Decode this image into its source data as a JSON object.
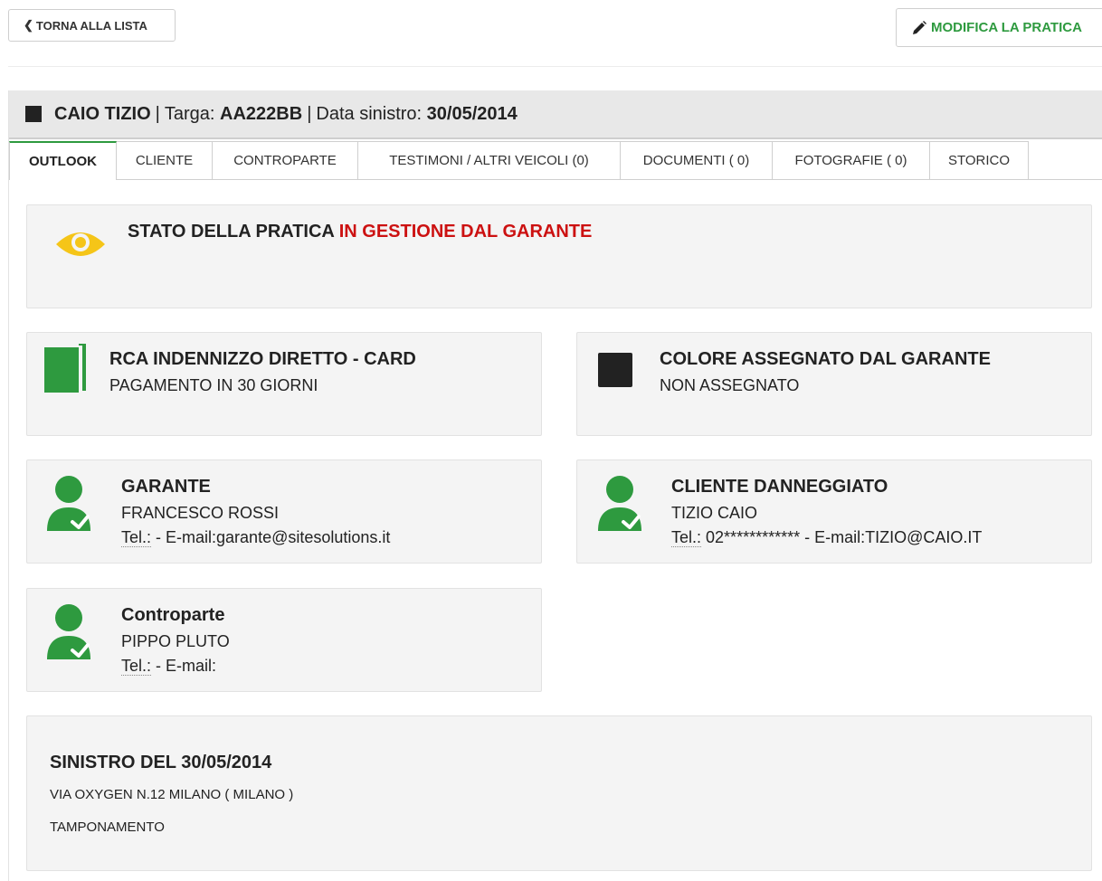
{
  "toolbar": {
    "back_label": "TORNA ALLA LISTA",
    "edit_label": "MODIFICA LA PRATICA"
  },
  "header": {
    "name": "CAIO TIZIO",
    "plate_label": "Targa:",
    "plate": "AA222BB",
    "date_label": "Data sinistro:",
    "date": "30/05/2014",
    "separator": "|"
  },
  "tabs": [
    {
      "label": "OUTLOOK"
    },
    {
      "label": "CLIENTE"
    },
    {
      "label": "CONTROPARTE"
    },
    {
      "label": "TESTIMONI / ALTRI VEICOLI (0)"
    },
    {
      "label": "DOCUMENTI ( 0)"
    },
    {
      "label": "FOTOGRAFIE ( 0)"
    },
    {
      "label": "STORICO"
    }
  ],
  "status": {
    "label": "STATO DELLA PRATICA",
    "value": "IN GESTIONE DAL GARANTE"
  },
  "coverage": {
    "title": "RCA INDENNIZZO DIRETTO - CARD",
    "subtitle": "PAGAMENTO IN 30 GIORNI"
  },
  "color": {
    "title": "COLORE ASSEGNATO DAL GARANTE",
    "subtitle": "NON ASSEGNATO"
  },
  "guarantor": {
    "title": "GARANTE",
    "name": "FRANCESCO ROSSI",
    "tel_label": "Tel.:",
    "contact": "- E-mail:garante@sitesolutions.it"
  },
  "client": {
    "title": "CLIENTE DANNEGGIATO",
    "name": "TIZIO CAIO",
    "tel_label": "Tel.:",
    "contact": "02************ - E-mail:TIZIO@CAIO.IT"
  },
  "counterpart": {
    "title": "Controparte",
    "name": "PIPPO PLUTO",
    "tel_label": "Tel.:",
    "contact": "- E-mail:"
  },
  "claim": {
    "title": "SINISTRO DEL 30/05/2014",
    "address": "VIA OXYGEN N.12  MILANO ( MILANO )",
    "type": "TAMPONAMENTO"
  },
  "colors": {
    "accent_green": "#2e9a3f",
    "status_red": "#cc1111",
    "eye_yellow": "#f5c518"
  }
}
